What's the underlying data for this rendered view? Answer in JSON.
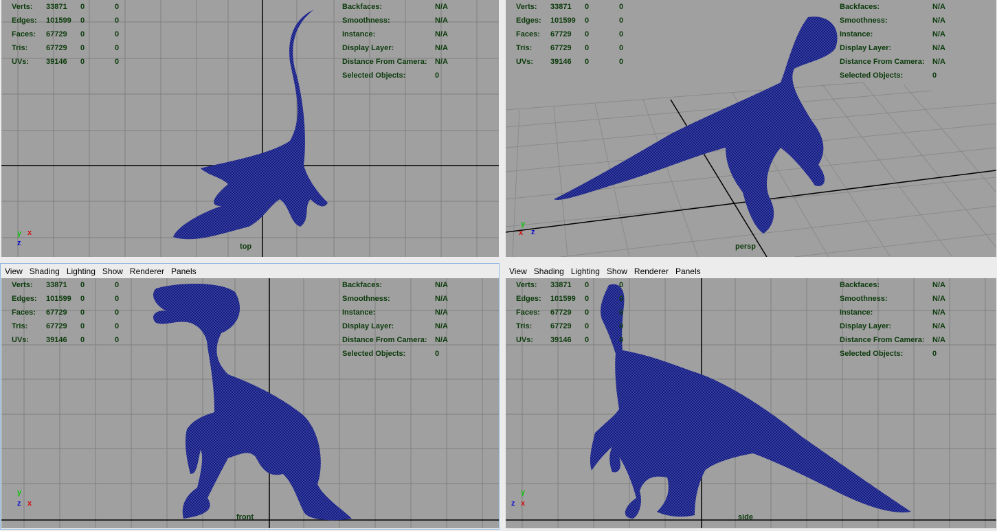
{
  "menu": [
    "View",
    "Shading",
    "Lighting",
    "Show",
    "Renderer",
    "Panels"
  ],
  "stats": [
    {
      "label": "Verts:",
      "v1": "33871",
      "v2": "0",
      "v3": "0"
    },
    {
      "label": "Edges:",
      "v1": "101599",
      "v2": "0",
      "v3": "0"
    },
    {
      "label": "Faces:",
      "v1": "67729",
      "v2": "0",
      "v3": "0"
    },
    {
      "label": "Tris:",
      "v1": "67729",
      "v2": "0",
      "v3": "0"
    },
    {
      "label": "UVs:",
      "v1": "39146",
      "v2": "0",
      "v3": "0"
    }
  ],
  "info": [
    {
      "label": "Backfaces:",
      "value": "N/A"
    },
    {
      "label": "Smoothness:",
      "value": "N/A"
    },
    {
      "label": "Instance:",
      "value": "N/A"
    },
    {
      "label": "Display Layer:",
      "value": "N/A"
    },
    {
      "label": "Distance From Camera:",
      "value": "N/A"
    },
    {
      "label": "Selected Objects:",
      "value": "0"
    }
  ],
  "viewports": {
    "top": {
      "camera": "top",
      "axes": [
        "y",
        "x",
        "z"
      ]
    },
    "persp": {
      "camera": "persp",
      "axes": [
        "y",
        "x",
        "z"
      ]
    },
    "front": {
      "camera": "front",
      "axes": [
        "y",
        "z",
        "x"
      ]
    },
    "side": {
      "camera": "side",
      "axes": [
        "y",
        "z",
        "x"
      ]
    }
  },
  "colors": {
    "viewport_bg": "#a0a0a0",
    "grid": "#808080",
    "mesh": "#141c82",
    "hud_text": "#0b3a0b",
    "axis_x": "#d01010",
    "axis_y": "#10c010",
    "axis_z": "#1010d0",
    "active_border": "#8fb8e3"
  }
}
